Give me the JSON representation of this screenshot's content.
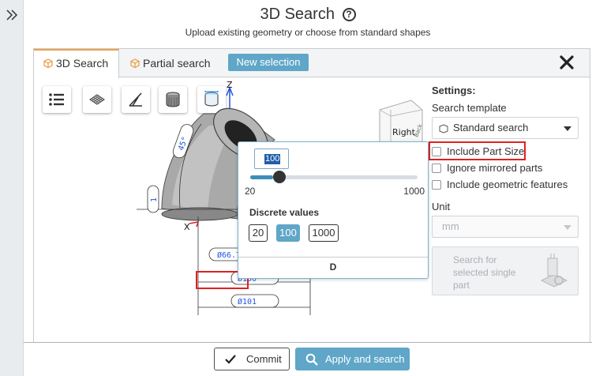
{
  "header": {
    "title": "3D Search",
    "help_icon": "?",
    "subtitle": "Upload existing geometry or choose from standard shapes"
  },
  "tabs": [
    {
      "label": "3D Search",
      "icon": "cube-icon",
      "active": true
    },
    {
      "label": "Partial search",
      "icon": "cube-icon",
      "active": false
    }
  ],
  "toolbar": {
    "new_selection": "New selection",
    "tools": [
      "list-icon",
      "mesh-icon",
      "angle-measure-icon",
      "shaded-cylinder-icon",
      "diameter-measure-icon"
    ]
  },
  "viewport": {
    "axis_z": "Z",
    "axis_x": "X",
    "view_cube_face": "Right",
    "view_cube_side": "Back",
    "dimensions": {
      "angle": "45°",
      "height": "1",
      "d_inner": "Ø66.7",
      "d_mid": "Ø100",
      "d_outer": "Ø101"
    }
  },
  "popup": {
    "current_value": "100",
    "slider": {
      "min": 20,
      "max": 1000,
      "value": 100
    },
    "min_label": "20",
    "max_label": "1000",
    "discrete_label": "Discrete values",
    "discrete_values": [
      "20",
      "100",
      "1000"
    ],
    "selected_value": "100",
    "parameter": "D"
  },
  "settings": {
    "heading": "Settings:",
    "template_label": "Search template",
    "template_value": "Standard search",
    "options": [
      {
        "label": "Include Part Size",
        "checked": false,
        "highlighted": true
      },
      {
        "label": "Ignore mirrored parts",
        "checked": false
      },
      {
        "label": "Include geometric features",
        "checked": false
      }
    ],
    "unit_label": "Unit",
    "unit_value": "mm",
    "search_part_btn": "Search for selected single part"
  },
  "footer": {
    "commit": "Commit",
    "apply": "Apply and search"
  },
  "colors": {
    "accent": "#5fa6c8",
    "highlight": "#e02020",
    "tab_accent": "#f0a14a"
  }
}
